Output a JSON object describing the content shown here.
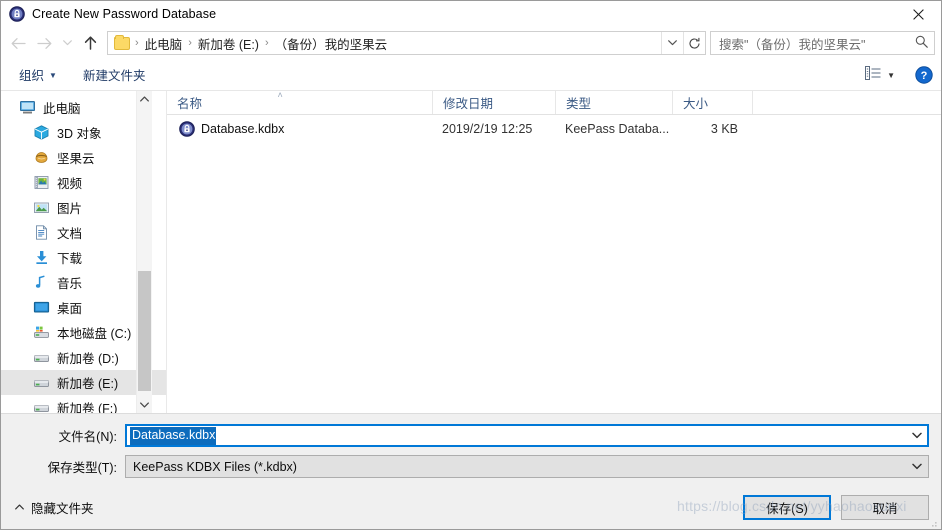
{
  "window": {
    "title": "Create New Password Database",
    "icon": "keepass-lock-icon",
    "close_label": "✕"
  },
  "nav": {
    "back_icon": "arrow-left-icon",
    "forward_icon": "arrow-right-icon",
    "recent_icon": "chevron-down-icon",
    "up_icon": "arrow-up-icon",
    "breadcrumbs": [
      {
        "label": "此电脑"
      },
      {
        "label": "新加卷 (E:)"
      },
      {
        "label": "（备份）我的坚果云"
      }
    ],
    "separator": "›",
    "dropdown_icon": "chevron-down-icon",
    "refresh_icon": "refresh-icon",
    "refresh_glyph": "↻"
  },
  "search": {
    "placeholder": "搜索\"（备份）我的坚果云\"",
    "icon": "search-icon"
  },
  "commandbar": {
    "organize_label": "组织",
    "organize_caret": "▼",
    "new_folder_label": "新建文件夹",
    "view_icon": "view-list-icon",
    "view_caret": "▼",
    "help_icon": "help-icon"
  },
  "sidebar": {
    "items": [
      {
        "label": "此电脑",
        "icon": "this-pc-icon",
        "level": 0,
        "selected": false
      },
      {
        "label": "3D 对象",
        "icon": "3d-objects-icon",
        "level": 1,
        "selected": false
      },
      {
        "label": "坚果云",
        "icon": "nutstore-icon",
        "level": 1,
        "selected": false
      },
      {
        "label": "视频",
        "icon": "videos-icon",
        "level": 1,
        "selected": false
      },
      {
        "label": "图片",
        "icon": "pictures-icon",
        "level": 1,
        "selected": false
      },
      {
        "label": "文档",
        "icon": "documents-icon",
        "level": 1,
        "selected": false
      },
      {
        "label": "下载",
        "icon": "downloads-icon",
        "level": 1,
        "selected": false
      },
      {
        "label": "音乐",
        "icon": "music-icon",
        "level": 1,
        "selected": false
      },
      {
        "label": "桌面",
        "icon": "desktop-icon",
        "level": 1,
        "selected": false
      },
      {
        "label": "本地磁盘 (C:)",
        "icon": "system-drive-icon",
        "level": 1,
        "selected": false
      },
      {
        "label": "新加卷 (D:)",
        "icon": "drive-icon",
        "level": 1,
        "selected": false
      },
      {
        "label": "新加卷 (E:)",
        "icon": "drive-icon",
        "level": 1,
        "selected": true
      },
      {
        "label": "新加卷 (F:)",
        "icon": "drive-icon",
        "level": 1,
        "selected": false
      }
    ],
    "scroll_up_icon": "chevron-up-icon",
    "scroll_down_icon": "chevron-down-icon"
  },
  "filelist": {
    "columns": [
      {
        "key": "name",
        "label": "名称",
        "sorted": true,
        "sort_glyph": "˄"
      },
      {
        "key": "date",
        "label": "修改日期",
        "sorted": false,
        "sort_glyph": ""
      },
      {
        "key": "type",
        "label": "类型",
        "sorted": false,
        "sort_glyph": ""
      },
      {
        "key": "size",
        "label": "大小",
        "sorted": false,
        "sort_glyph": ""
      }
    ],
    "rows": [
      {
        "icon": "kdbx-file-icon",
        "name": "Database.kdbx",
        "date": "2019/2/19 12:25",
        "type": "KeePass Databa...",
        "size": "3 KB"
      }
    ]
  },
  "form": {
    "filename_label": "文件名(N):",
    "filename_value": "Database.kdbx",
    "filename_caret": "⌄",
    "filetype_label": "保存类型(T):",
    "filetype_value": "KeePass KDBX Files (*.kdbx)",
    "filetype_caret": "⌄"
  },
  "footer": {
    "hide_folders_label": "隐藏文件夹",
    "hide_folders_caret": "˄",
    "save_label": "保存(S)",
    "cancel_label": "取消"
  },
  "watermark": {
    "text": "https://blog.csdn.net/yyhaohaoxuexi"
  },
  "colors": {
    "accent": "#0078d7",
    "selection": "#0d6cbd",
    "tree_selected": "#e5e5e5",
    "chrome": "#f0f0f0"
  }
}
